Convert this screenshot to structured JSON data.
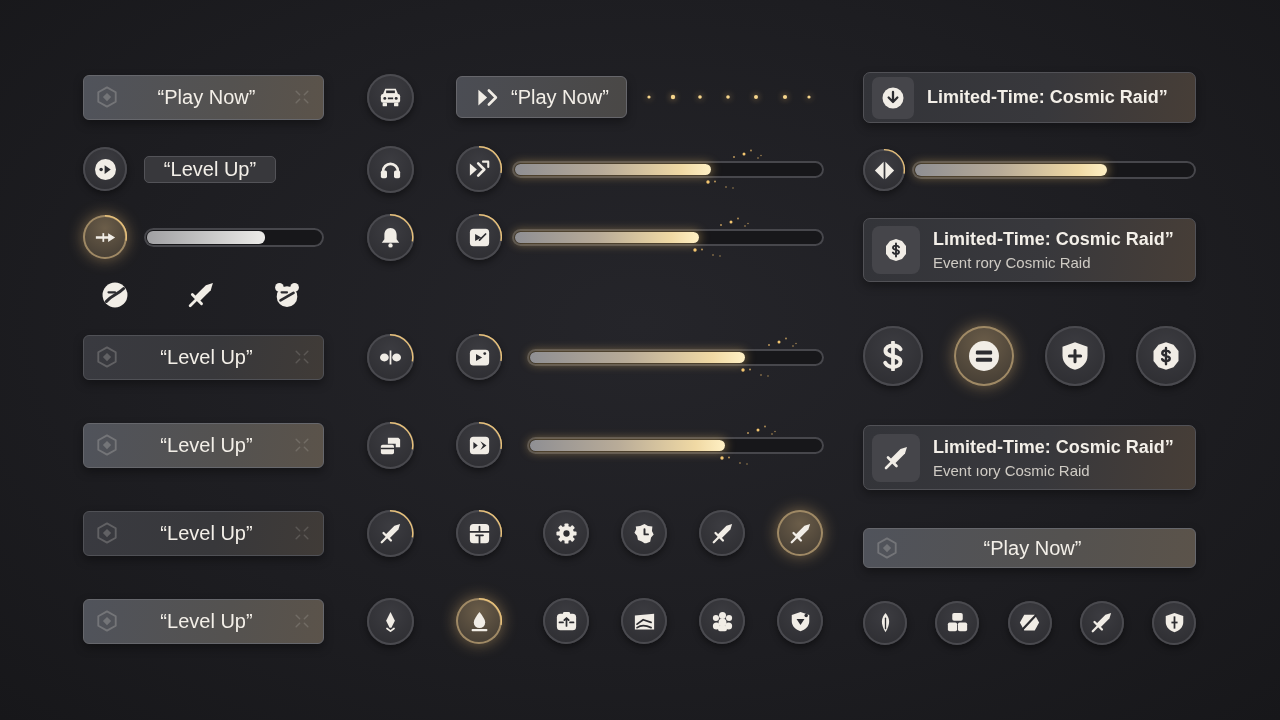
{
  "rows": [
    {
      "left": [
        {
          "kind": "wide_button",
          "label": "“Play Now”",
          "highlighted": true
        }
      ],
      "middle": [
        {
          "kind": "icon_button",
          "ring": false,
          "active": false
        }
      ],
      "right": [
        {
          "kind": "icon_text_button",
          "label": "“Play Now”"
        },
        {
          "kind": "dots"
        }
      ]
    },
    {
      "left": [
        {
          "kind": "icon_button",
          "ring": false,
          "active": false
        },
        {
          "kind": "small_button",
          "label": "“Level Up”"
        }
      ],
      "middle": [
        {
          "kind": "icon_button",
          "ring": false,
          "active": false
        }
      ],
      "right": [
        {
          "kind": "icon_button",
          "ring": true,
          "active": false
        },
        {
          "kind": "progress",
          "level": 0.64
        }
      ]
    },
    {
      "left": [
        {
          "kind": "icon_button",
          "ring": true,
          "active": true
        },
        {
          "kind": "progress",
          "level": 0.68
        }
      ],
      "middle": [
        {
          "kind": "icon_button",
          "ring": true,
          "active": false
        }
      ],
      "right": [
        {
          "kind": "icon_button",
          "ring": true,
          "active": false
        },
        {
          "kind": "progress",
          "level": 0.6
        }
      ]
    },
    {
      "left": [
        {
          "kind": "icon"
        },
        {
          "kind": "icon"
        },
        {
          "kind": "icon"
        }
      ]
    },
    {
      "left": [
        {
          "kind": "wide_button",
          "label": "“Level Up”",
          "highlighted": false
        }
      ],
      "middle": [
        {
          "kind": "icon_button",
          "ring": true,
          "active": false
        }
      ],
      "right": [
        {
          "kind": "icon_button",
          "ring": true,
          "active": false
        },
        {
          "kind": "progress",
          "level": 0.74
        }
      ]
    },
    {
      "left": [
        {
          "kind": "wide_button",
          "label": "“Level Up”",
          "highlighted": true
        }
      ],
      "middle": [
        {
          "kind": "icon_button",
          "ring": true,
          "active": false
        }
      ],
      "right": [
        {
          "kind": "icon_button",
          "ring": true,
          "active": false
        },
        {
          "kind": "progress",
          "level": 0.67
        }
      ]
    },
    {
      "left": [
        {
          "kind": "wide_button",
          "label": "“Level Up”",
          "highlighted": false
        }
      ],
      "middle": [
        {
          "kind": "icon_button",
          "ring": true,
          "active": false
        }
      ],
      "right": [
        {
          "kind": "icon_button",
          "ring": true,
          "active": false
        },
        {
          "kind": "icon_button",
          "ring": false,
          "active": false
        },
        {
          "kind": "icon_button",
          "ring": false,
          "active": false
        },
        {
          "kind": "icon_button",
          "ring": false,
          "active": false
        },
        {
          "kind": "icon_button",
          "ring": false,
          "active": true
        }
      ]
    },
    {
      "left": [
        {
          "kind": "wide_button",
          "label": "“Level Up”",
          "highlighted": true
        }
      ],
      "middle": [
        {
          "kind": "icon_button",
          "ring": false,
          "active": false
        }
      ],
      "right": [
        {
          "kind": "icon_button",
          "ring": true,
          "active": true
        },
        {
          "kind": "icon_button",
          "ring": false,
          "active": false
        },
        {
          "kind": "icon_button",
          "ring": false,
          "active": false
        },
        {
          "kind": "icon_button",
          "ring": false,
          "active": false
        },
        {
          "kind": "icon_button",
          "ring": false,
          "active": false
        }
      ]
    }
  ],
  "side_column": [
    {
      "items": [
        {
          "kind": "event_card",
          "title": "Limited-Time: Cosmic Raid”"
        }
      ]
    },
    {
      "items": [
        {
          "kind": "icon_button",
          "ring": true,
          "active": false
        },
        {
          "kind": "progress",
          "level": 0.69
        }
      ]
    },
    {
      "items": [
        {
          "kind": "event_card",
          "title": "Limited-Time: Cosmic Raid”",
          "subtitle": "Event rory Cosmic Raid"
        }
      ]
    },
    {
      "items": [
        {
          "kind": "icon_button",
          "ring": false,
          "active": false
        },
        {
          "kind": "icon_button",
          "ring": false,
          "active": true
        },
        {
          "kind": "icon_button",
          "ring": false,
          "active": false
        },
        {
          "kind": "icon_button",
          "ring": false,
          "active": false
        }
      ]
    },
    {
      "items": [
        {
          "kind": "event_card",
          "title": "Limited-Time: Cosmic Raid”",
          "subtitle": "Event ıory Cosmic Raid"
        }
      ]
    },
    {
      "items": [
        {
          "kind": "wide_button",
          "label": "“Play Now”",
          "highlighted": true
        }
      ]
    },
    {
      "items": [
        {
          "kind": "icon_button",
          "ring": false,
          "active": false
        },
        {
          "kind": "icon_button",
          "ring": false,
          "active": false
        },
        {
          "kind": "icon_button",
          "ring": false,
          "active": false
        },
        {
          "kind": "icon_button",
          "ring": false,
          "active": false
        },
        {
          "kind": "icon_button",
          "ring": false,
          "active": false
        }
      ]
    }
  ]
}
